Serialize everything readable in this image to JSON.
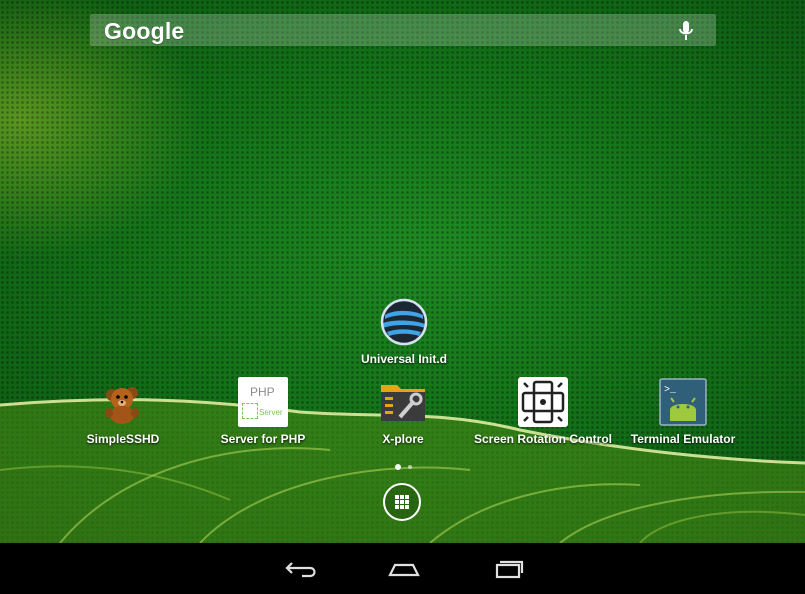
{
  "search": {
    "logo_text": "Google",
    "mic_icon": "microphone-icon"
  },
  "apps_upper": [
    {
      "label": "Universal Init.d",
      "icon": "universal-initd-icon"
    }
  ],
  "apps_row": [
    {
      "label": "SimpleSSHD",
      "icon": "teddy-bear-icon"
    },
    {
      "label": "Server for PHP",
      "icon": "php-server-icon",
      "icon_text_top": "PHP",
      "icon_text_bottom": "Server"
    },
    {
      "label": "X-plore",
      "icon": "xplore-folder-icon"
    },
    {
      "label": "Screen Rotation Control",
      "icon": "screen-rotation-icon"
    },
    {
      "label": "Terminal Emulator",
      "icon": "terminal-emulator-icon"
    }
  ],
  "page_indicator": {
    "pages": 2,
    "current": 1
  },
  "all_apps_icon": "app-drawer-icon",
  "navbar": {
    "back_icon": "back-icon",
    "home_icon": "home-icon",
    "recents_icon": "recent-apps-icon"
  },
  "colors": {
    "wallpaper": "#137018",
    "navbar": "#000000",
    "label": "#ffffff"
  }
}
